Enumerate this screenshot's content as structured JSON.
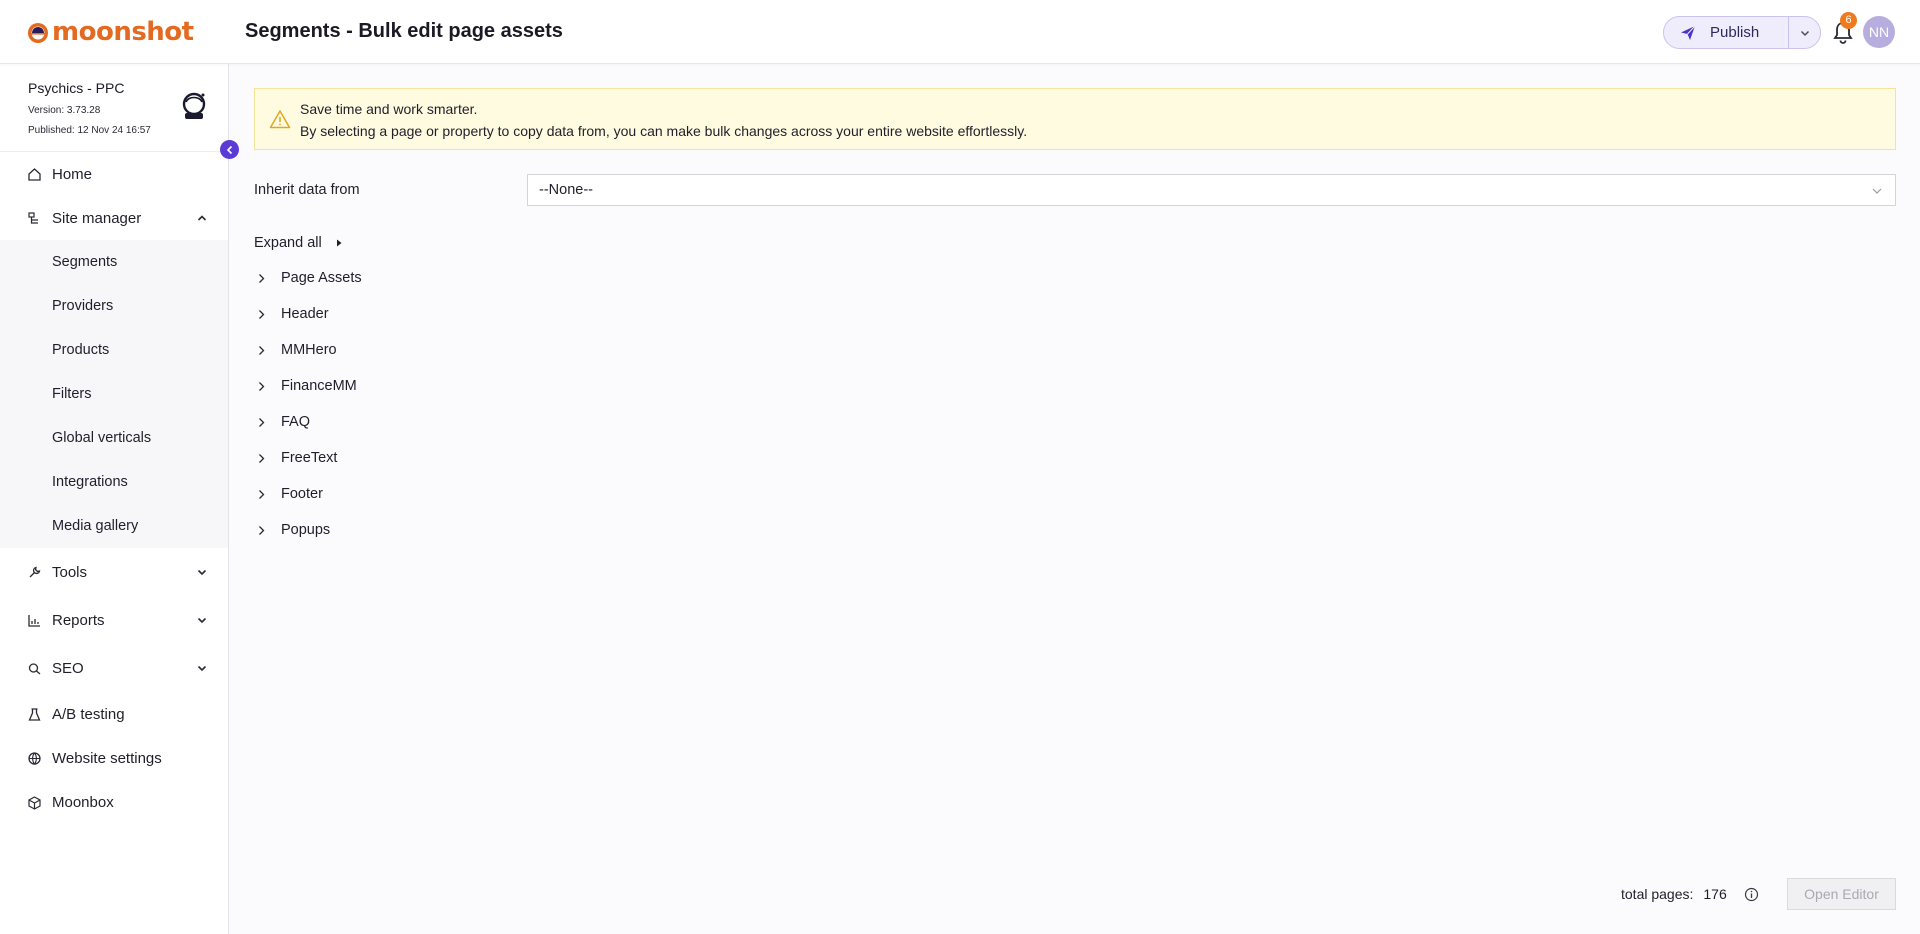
{
  "app": {
    "logo_text": "moonshot"
  },
  "header": {
    "title": "Segments - Bulk edit page assets",
    "publish_label": "Publish",
    "notification_count": "6",
    "avatar_initials": "NN"
  },
  "site": {
    "name": "Psychics - PPC",
    "version": "Version: 3.73.28",
    "published": "Published: 12 Nov 24 16:57"
  },
  "sidebar": {
    "items": [
      {
        "label": "Home",
        "icon": "home-icon"
      },
      {
        "label": "Site manager",
        "icon": "sitemap-icon",
        "expanded": true
      },
      {
        "label": "Tools",
        "icon": "wrench-icon"
      },
      {
        "label": "Reports",
        "icon": "chart-icon"
      },
      {
        "label": "SEO",
        "icon": "seo-icon"
      },
      {
        "label": "A/B testing",
        "icon": "flask-icon"
      },
      {
        "label": "Website settings",
        "icon": "globe-icon"
      },
      {
        "label": "Moonbox",
        "icon": "box-icon"
      }
    ],
    "site_manager_children": [
      "Segments",
      "Providers",
      "Products",
      "Filters",
      "Global verticals",
      "Integrations",
      "Media gallery"
    ]
  },
  "alert": {
    "line1": "Save time and work smarter.",
    "line2": "By selecting a page or property to copy data from, you can make bulk changes across your entire website effortlessly."
  },
  "inherit": {
    "label": "Inherit data from",
    "selected": "--None--"
  },
  "tree": {
    "expand_all_label": "Expand all",
    "items": [
      "Page Assets",
      "Header",
      "MMHero",
      "FinanceMM",
      "FAQ",
      "FreeText",
      "Footer",
      "Popups"
    ]
  },
  "footer": {
    "total_label": "total pages:",
    "total_value": "176",
    "open_editor_label": "Open Editor"
  },
  "colors": {
    "brand": "#e36a20",
    "accent": "#5b3bd6",
    "alert_bg": "#fffbe0",
    "badge": "#f07a1e"
  }
}
